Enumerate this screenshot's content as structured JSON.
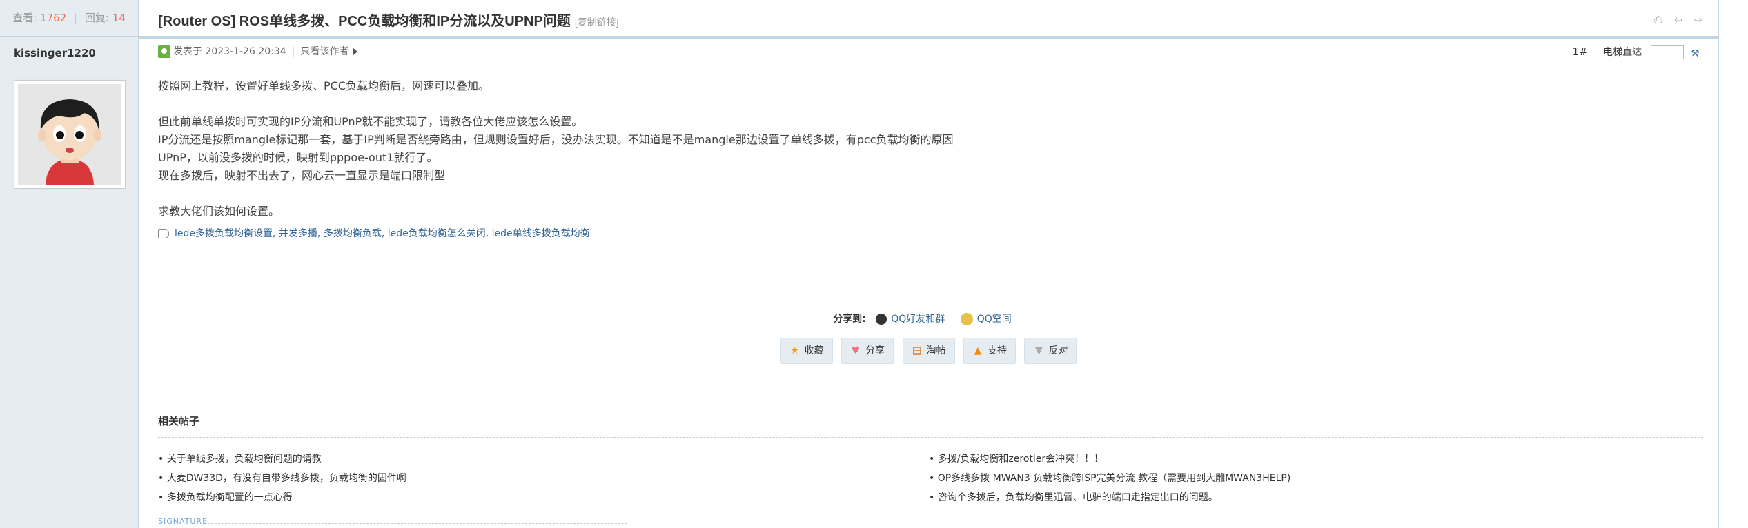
{
  "sidebar": {
    "views_label": "查看:",
    "views": "1762",
    "replies_label": "回复:",
    "replies": "14",
    "author": "kissinger1220"
  },
  "thread": {
    "title": "[Router OS] ROS单线多拨、PCC负载均衡和IP分流以及UPNP问题",
    "copy_link": "[复制链接]",
    "posted_label": "发表于 2023-1-26 20:34",
    "only_author": "只看该作者",
    "floor": "1#",
    "elevator": "电梯直达"
  },
  "content": {
    "lines": [
      "按照网上教程，设置好单线多拨、PCC负载均衡后，网速可以叠加。",
      "",
      "但此前单线单拨时可实现的IP分流和UPnP就不能实现了，请教各位大佬应该怎么设置。",
      "IP分流还是按照mangle标记那一套，基于IP判断是否绕旁路由，但规则设置好后，没办法实现。不知道是不是mangle那边设置了单线多拨，有pcc负载均衡的原因",
      "UPnP，以前没多拨的时候，映射到pppoe-out1就行了。",
      "现在多拨后，映射不出去了，网心云一直显示是端口限制型",
      "",
      "求教大佬们该如何设置。"
    ]
  },
  "tags": [
    "lede多拨负载均衡设置",
    "并发多播",
    "多拨均衡负载",
    "lede负载均衡怎么关闭",
    "lede单线多拨负载均衡"
  ],
  "share": {
    "label": "分享到:",
    "qq": "QQ好友和群",
    "qzone": "QQ空间"
  },
  "actions": [
    "收藏",
    "分享",
    "淘帖",
    "支持",
    "反对"
  ],
  "related": {
    "title": "相关帖子",
    "left": [
      "• 关于单线多拨，负载均衡问题的请教",
      "• 大麦DW33D，有没有自带多线多拨，负载均衡的固件啊",
      "• 多拨负载均衡配置的一点心得"
    ],
    "right": [
      "• 多拨/负载均衡和zerotier会冲突！！！",
      "• OP多线多拨 MWAN3 负载均衡跨ISP完美分流 教程（需要用到大雕MWAN3HELP)",
      "• 咨询个多拨后，负载均衡里迅雷、电驴的端口走指定出口的问题。"
    ]
  },
  "signature_label": "SIGNATURE"
}
